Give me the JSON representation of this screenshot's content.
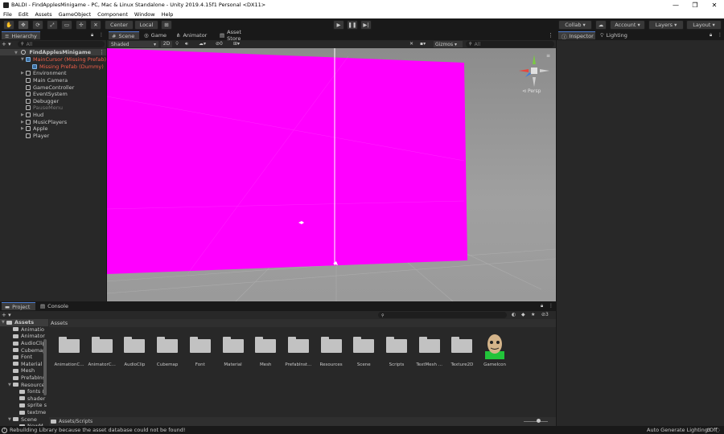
{
  "window": {
    "title": "BALDI - FindApplesMinigame - PC, Mac & Linux Standalone - Unity 2019.4.15f1 Personal <DX11>",
    "minimize": "—",
    "maximize": "❐",
    "close": "✕"
  },
  "menu": [
    "File",
    "Edit",
    "Assets",
    "GameObject",
    "Component",
    "Window",
    "Help"
  ],
  "toolbar": {
    "pivot_center": "Center",
    "pivot_local": "Local",
    "collab": "Collab",
    "account": "Account",
    "layers": "Layers",
    "layout": "Layout"
  },
  "hierarchy": {
    "tab": "Hierarchy",
    "search_placeholder": "All",
    "scene": "FindApplesMinigame",
    "items": [
      {
        "label": "MainCursor (Missing Prefab)",
        "indent": 1,
        "missing": true,
        "expanded": true
      },
      {
        "label": "Missing Prefab (Dummy)",
        "indent": 2,
        "missing": true,
        "expanded": false
      },
      {
        "label": "Environment",
        "indent": 1,
        "missing": false,
        "expanded": false
      },
      {
        "label": "Main Camera",
        "indent": 1,
        "missing": false,
        "expanded": false
      },
      {
        "label": "GameController",
        "indent": 1,
        "missing": false,
        "expanded": false
      },
      {
        "label": "EventSystem",
        "indent": 1,
        "missing": false,
        "expanded": false
      },
      {
        "label": "Debugger",
        "indent": 1,
        "missing": false,
        "expanded": false
      },
      {
        "label": "PauseMenu",
        "indent": 1,
        "missing": false,
        "expanded": false,
        "inactive": true
      },
      {
        "label": "Hud",
        "indent": 1,
        "missing": false,
        "expanded": false
      },
      {
        "label": "MusicPlayers",
        "indent": 1,
        "missing": false,
        "expanded": false
      },
      {
        "label": "Apple",
        "indent": 1,
        "missing": false,
        "expanded": false
      },
      {
        "label": "Player",
        "indent": 1,
        "missing": false,
        "expanded": false
      }
    ]
  },
  "scene": {
    "tabs": [
      "Scene",
      "Game",
      "Animator",
      "Asset Store"
    ],
    "shading": "Shaded",
    "mode_2d": "2D",
    "hidden_count": "0",
    "gizmos": "Gizmos",
    "search_placeholder": "All",
    "persp": "Persp",
    "colors": {
      "magenta": "#ff00ff",
      "floor": "#9a9a9a",
      "grid": "#a9a9a9"
    }
  },
  "inspector": {
    "tabs": [
      "Inspector",
      "Lighting"
    ]
  },
  "project": {
    "tabs": [
      "Project",
      "Console"
    ],
    "search_count": "3",
    "tree": [
      {
        "label": "Assets",
        "indent": 0
      },
      {
        "label": "Animatio",
        "indent": 1
      },
      {
        "label": "Animator",
        "indent": 1
      },
      {
        "label": "AudioClip",
        "indent": 1
      },
      {
        "label": "Cubemap",
        "indent": 1
      },
      {
        "label": "Font",
        "indent": 1
      },
      {
        "label": "Material",
        "indent": 1
      },
      {
        "label": "Mesh",
        "indent": 1
      },
      {
        "label": "PrefabIns",
        "indent": 1
      },
      {
        "label": "Resource",
        "indent": 1
      },
      {
        "label": "fonts &",
        "indent": 2
      },
      {
        "label": "shader",
        "indent": 2
      },
      {
        "label": "sprite s",
        "indent": 2
      },
      {
        "label": "textme",
        "indent": 2
      },
      {
        "label": "Scene",
        "indent": 1
      },
      {
        "label": "NewM",
        "indent": 2
      }
    ],
    "breadcrumb": "Assets",
    "folders": [
      "AnimationC...",
      "AnimatorC...",
      "AudioClip",
      "Cubemap",
      "Font",
      "Material",
      "Mesh",
      "PrefabInst...",
      "Resources",
      "Scene",
      "Scripts",
      "TextMesh ...",
      "Texture2D",
      "GameIcon"
    ],
    "selected_path": "Assets/Scripts"
  },
  "status": {
    "message": "Rebuilding Library because the asset database could not be found!",
    "lighting": "Auto Generate Lighting Off"
  }
}
